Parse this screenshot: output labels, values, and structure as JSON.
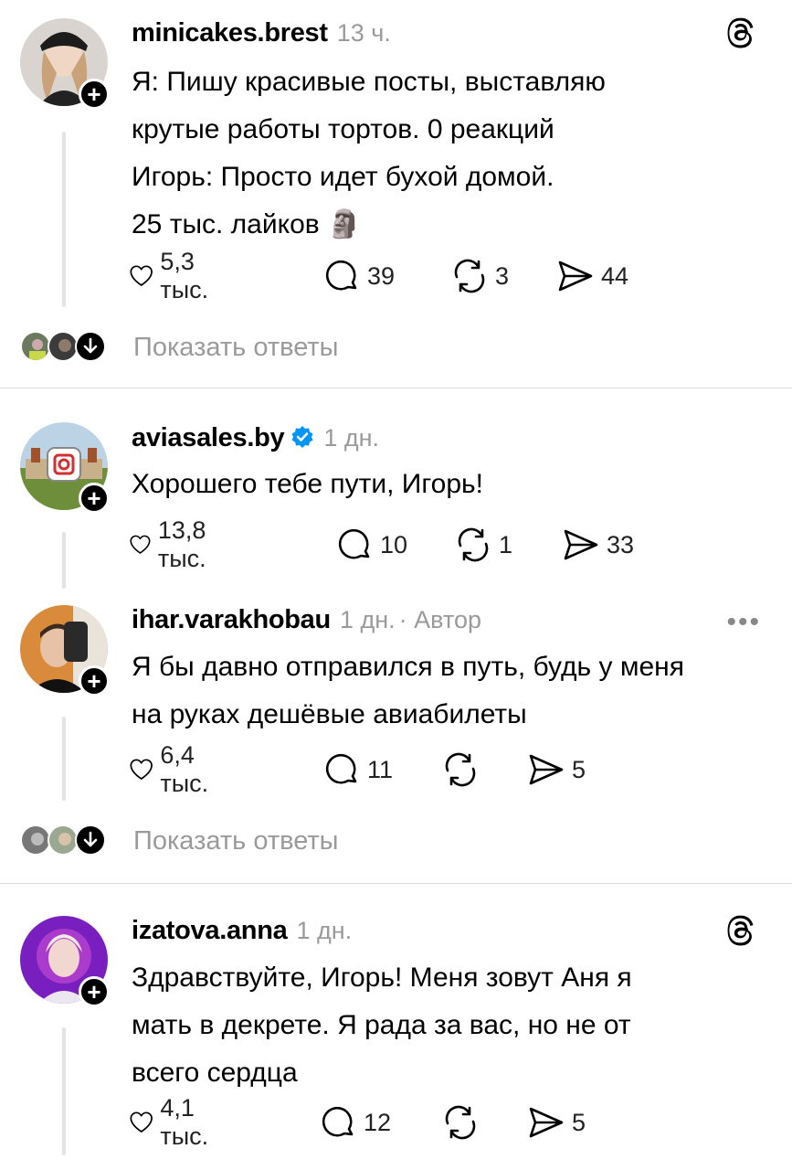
{
  "posts": [
    {
      "username": "minicakes.brest",
      "time": "13 ч.",
      "lines": [
        "Я: Пишу красивые посты, выставляю",
        "крутые работы тортов. 0 реакций",
        "Игорь: Просто идет бухой домой.",
        "25 тыс. лайков"
      ],
      "emoji": "🗿",
      "likes": "5,3 тыс.",
      "comments": "39",
      "reposts": "3",
      "shares": "44",
      "show_replies": "Показать ответы"
    },
    {
      "username": "aviasales.by",
      "verified": true,
      "time": "1 дн.",
      "lines": [
        "Хорошего тебе пути, Игорь!"
      ],
      "likes": "13,8 тыс.",
      "comments": "10",
      "reposts": "1",
      "shares": "33"
    },
    {
      "username": "ihar.varakhobau",
      "time": "1 дн.",
      "author_tag": "· Автор",
      "lines": [
        "Я бы давно отправился в путь, будь у меня",
        "на руках дешёвые авиабилеты"
      ],
      "likes": "6,4 тыс.",
      "comments": "11",
      "reposts": "",
      "shares": "5",
      "more": "•••",
      "show_replies": "Показать ответы"
    },
    {
      "username": "izatova.anna",
      "time": "1 дн.",
      "lines": [
        "Здравствуйте, Игорь! Меня зовут Аня я",
        "мать в декрете. Я рада за вас, но не от",
        "всего сердца"
      ],
      "likes": "4,1 тыс.",
      "comments": "12",
      "reposts": "",
      "shares": "5"
    }
  ],
  "colors": {
    "text": "#000000",
    "secondary": "#9a9a9a",
    "verified": "#0095f6",
    "divider": "#dcdcdc"
  }
}
